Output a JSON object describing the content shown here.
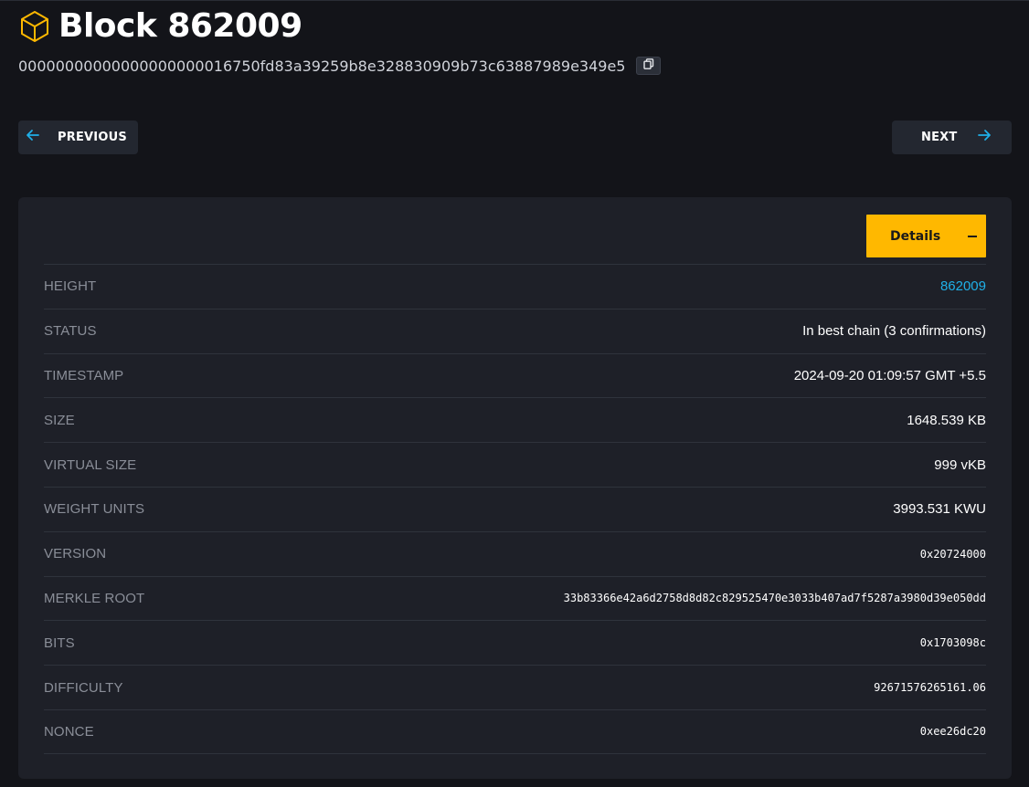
{
  "page": {
    "title": "Block 862009",
    "block_hash": "00000000000000000000016750fd83a39259b8e328830909b73c63887989e349e5"
  },
  "nav": {
    "previous_label": "PREVIOUS",
    "next_label": "NEXT"
  },
  "details": {
    "toggle_label": "Details",
    "rows": [
      {
        "key": "HEIGHT",
        "value": "862009"
      },
      {
        "key": "STATUS",
        "value": "In best chain (3 confirmations)"
      },
      {
        "key": "TIMESTAMP",
        "value": "2024-09-20 01:09:57 GMT +5.5"
      },
      {
        "key": "SIZE",
        "value": "1648.539 KB"
      },
      {
        "key": "VIRTUAL SIZE",
        "value": "999 vKB"
      },
      {
        "key": "WEIGHT UNITS",
        "value": "3993.531 KWU"
      },
      {
        "key": "VERSION",
        "value": "0x20724000"
      },
      {
        "key": "MERKLE ROOT",
        "value": "33b83366e42a6d2758d8d82c829525470e3033b407ad7f5287a3980d39e050dd"
      },
      {
        "key": "BITS",
        "value": "0x1703098c"
      },
      {
        "key": "DIFFICULTY",
        "value": "92671576265161.06"
      },
      {
        "key": "NONCE",
        "value": "0xee26dc20"
      }
    ]
  },
  "icons": {
    "title_icon": "cube-icon",
    "copy_icon": "copy-icon",
    "prev_icon": "arrow-left-icon",
    "next_icon": "arrow-right-icon"
  },
  "colors": {
    "accent": "#ffb800",
    "link": "#1fb0e8",
    "background": "#131419",
    "card": "#1e2028"
  }
}
